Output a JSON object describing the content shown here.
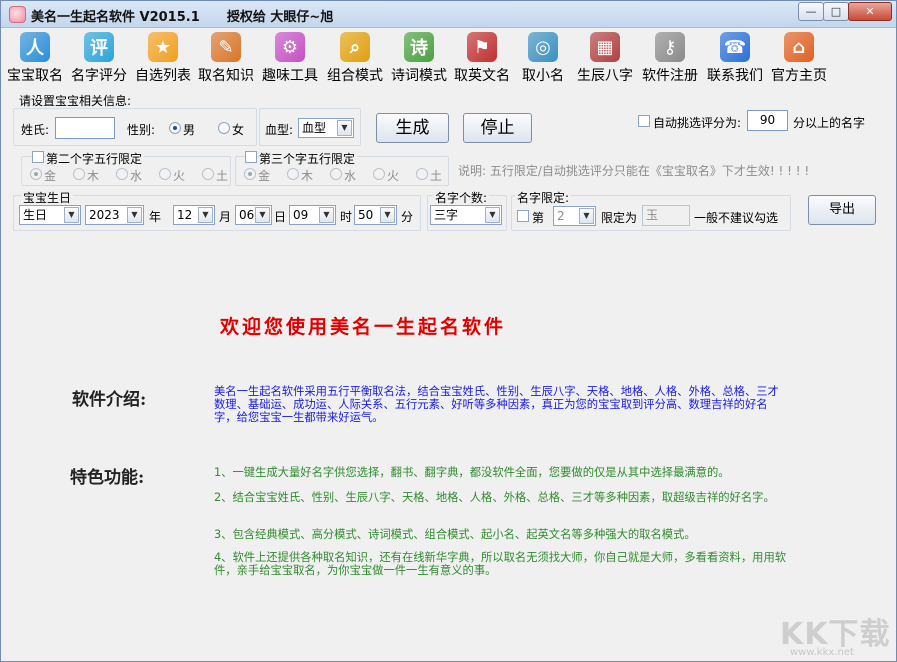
{
  "window": {
    "title": "美名一生起名软件 V2015.1      授权给 大眼仔~旭",
    "min_glyph": "—",
    "max_glyph": "□",
    "close_glyph": "✕"
  },
  "toolbar": [
    {
      "label": "宝宝取名",
      "icon": "baby-people-icon",
      "color": "#2a8fd8",
      "glyph": "人"
    },
    {
      "label": "名字评分",
      "icon": "score-icon",
      "color": "#2aa4d8",
      "glyph": "评"
    },
    {
      "label": "自选列表",
      "icon": "star-list-icon",
      "color": "#f0a020",
      "glyph": "★"
    },
    {
      "label": "取名知识",
      "icon": "notebook-pen-icon",
      "color": "#d8752a",
      "glyph": "✎"
    },
    {
      "label": "趣味工具",
      "icon": "gear-icon",
      "color": "#c54fc5",
      "glyph": "⚙"
    },
    {
      "label": "组合模式",
      "icon": "magnifier-icon",
      "color": "#e0a010",
      "glyph": "⌕"
    },
    {
      "label": "诗词模式",
      "icon": "poem-book-icon",
      "color": "#4aa040",
      "glyph": "诗"
    },
    {
      "label": "取英文名",
      "icon": "flag-icon",
      "color": "#c03030",
      "glyph": "⚑"
    },
    {
      "label": "取小名",
      "icon": "globe-satellite-icon",
      "color": "#3a90c0",
      "glyph": "◎"
    },
    {
      "label": "生辰八字",
      "icon": "calendar-grid-icon",
      "color": "#b04040",
      "glyph": "▦"
    },
    {
      "label": "软件注册",
      "icon": "key-tools-icon",
      "color": "#8a8a8a",
      "glyph": "⚷"
    },
    {
      "label": "联系我们",
      "icon": "contact-icon",
      "color": "#2a6fd8",
      "glyph": "☎"
    },
    {
      "label": "官方主页",
      "icon": "home-icon",
      "color": "#e06020",
      "glyph": "⌂"
    }
  ],
  "settings": {
    "heading": "请设置宝宝相关信息:",
    "surname_label": "姓氏:",
    "surname_value": "",
    "gender_label": "性别:",
    "gender_male": "男",
    "gender_female": "女",
    "gender_selected": "男",
    "blood_label": "血型:",
    "blood_value": "血型",
    "generate_btn": "生成",
    "stop_btn": "停止",
    "auto_pick_label": "自动挑选评分为:",
    "auto_pick_score": "90",
    "auto_pick_suffix": "分以上的名字",
    "auto_pick_checked": false,
    "wuxing2_label": "第二个字五行限定",
    "wuxing3_label": "第三个字五行限定",
    "wuxing_options": [
      "金",
      "木",
      "水",
      "火",
      "土"
    ],
    "wuxing_selected": "金",
    "note": "说明: 五行限定/自动挑选评分只能在《宝宝取名》下才生效! ! ! ! !",
    "birth_label": "宝宝生日",
    "birth_calendar": "生日",
    "birth_year": "2023",
    "year_unit": "年",
    "birth_month": "12",
    "month_unit": "月",
    "birth_day": "06",
    "day_unit": "日",
    "birth_hour": "09",
    "hour_unit": "时",
    "birth_minute": "50",
    "minute_unit": "分",
    "name_count_label": "名字个数:",
    "name_count_value": "三字",
    "name_limit_label": "名字限定:",
    "limit_pos_prefix": "第",
    "limit_pos_value": "2",
    "limit_as_label": "限定为",
    "limit_char": "玉",
    "limit_hint": "一般不建议勾选",
    "export_btn": "导出"
  },
  "content": {
    "welcome": "欢迎您使用美名一生起名软件",
    "intro_title": "软件介绍:",
    "intro_text": "美名一生起名软件采用五行平衡取名法，结合宝宝姓氏、性别、生辰八字、天格、地格、人格、外格、总格、三才数理、基础运、成功运、人际关系、五行元素、好听等多种因素，真正为您的宝宝取到评分高、数理吉祥的好名字，给您宝宝一生都带来好运气。",
    "features_title": "特色功能:",
    "features": [
      "1、一键生成大量好名字供您选择，翻书、翻字典，都没软件全面，您要做的仅是从其中选择最满意的。",
      "2、结合宝宝姓氏、性别、生辰八字、天格、地格、人格、外格、总格、三才等多种因素，取超级吉祥的好名字。",
      "3、包含经典模式、高分模式、诗词模式、组合模式、起小名、起英文名等多种强大的取名模式。",
      "4、软件上还提供各种取名知识，还有在线新华字典，所以取名无须找大师，你自己就是大师，多看看资料，用用软件，亲手给宝宝取名，为你宝宝做一件一生有意义的事。"
    ],
    "watermark": "KK下载",
    "watermark_url": "www.kkx.net"
  }
}
